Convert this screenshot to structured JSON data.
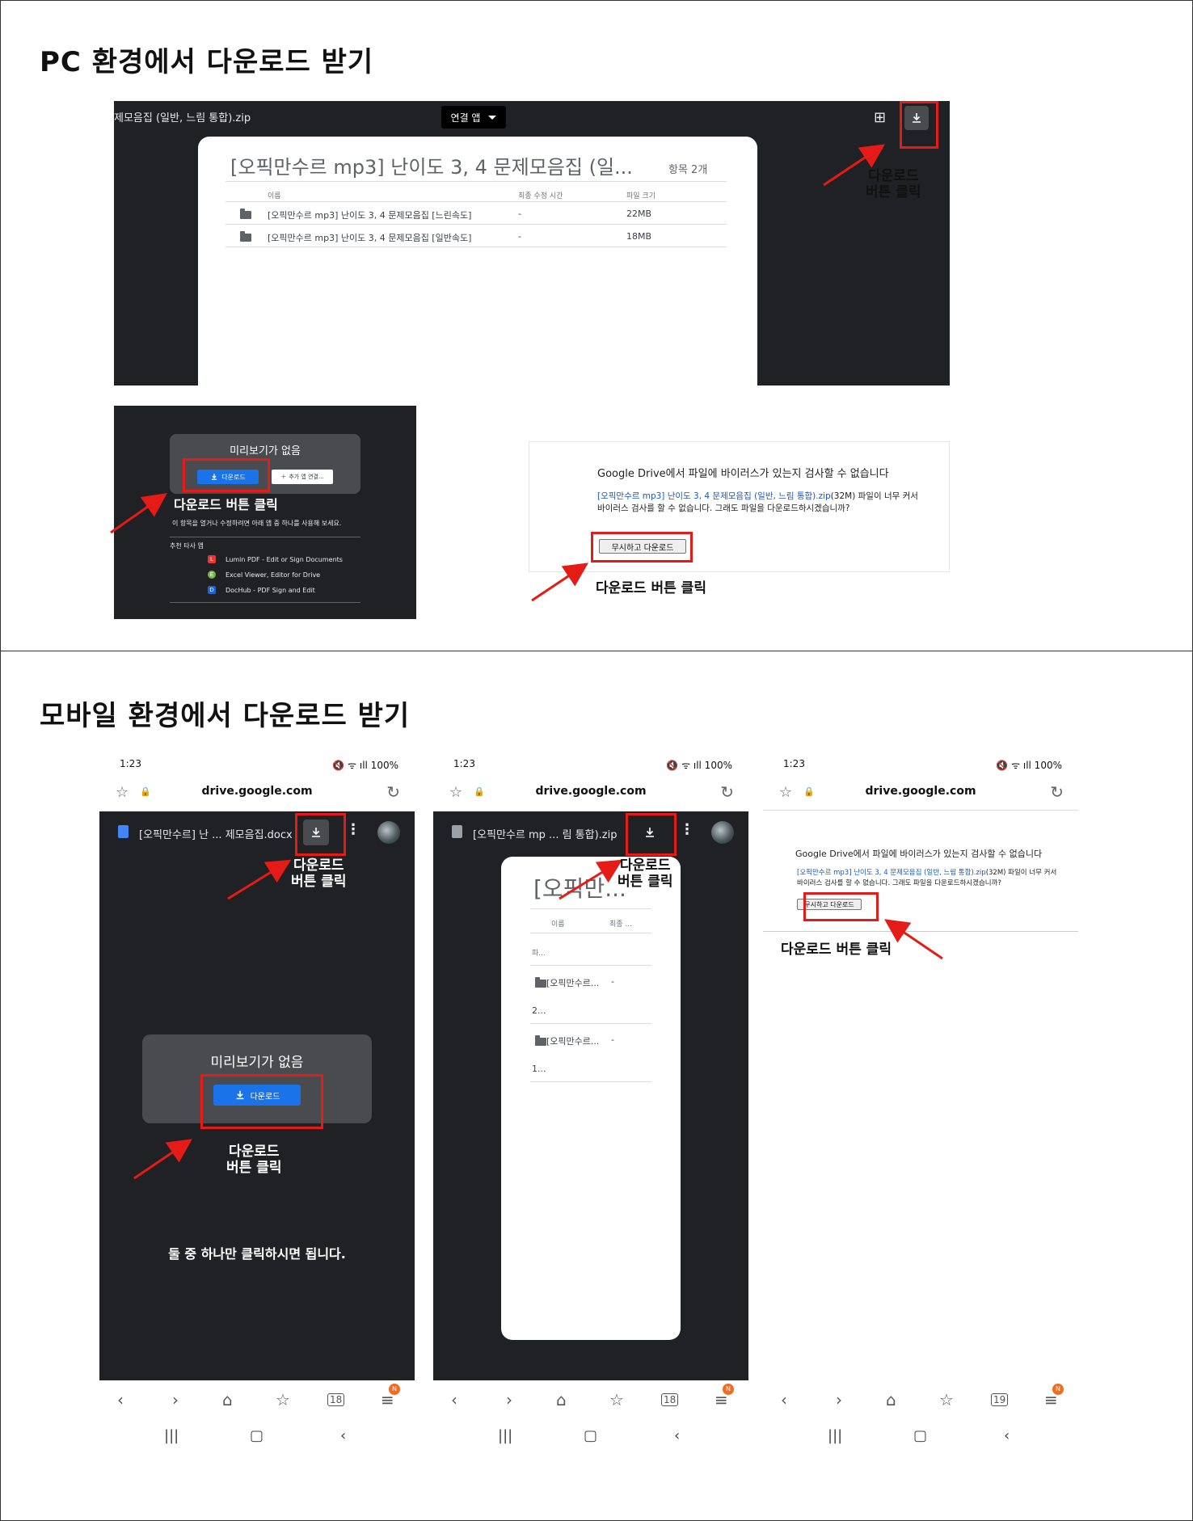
{
  "pc_section": {
    "title": "PC 환경에서 다운로드 받기",
    "viewer": {
      "filename": "제모음집 (일반, 느림 통합).zip",
      "open_with": "연결 앱",
      "folder_title": "[오픽만수르 mp3] 난이도 3, 4 문제모음집 (일...",
      "item_count": "항목 2개",
      "columns": [
        "이름",
        "최종 수정 시간",
        "파일 크기"
      ],
      "rows": [
        {
          "name": "[오픽만수르 mp3] 난이도 3, 4 문제모음집 [느린속도]",
          "modified": "-",
          "size": "22MB"
        },
        {
          "name": "[오픽만수르 mp3] 난이도 3, 4 문제모음집 [일반속도]",
          "modified": "-",
          "size": "18MB"
        }
      ],
      "annotation": "다운로드\n버튼 클릭"
    },
    "no_preview": {
      "title": "미리보기가 없음",
      "download_label": "다운로드",
      "add_app_label": "추가 앱 연결...",
      "hint": "이 항목을 열거나 수정하려면 아래 앱 중 하나를 사용해 보세요.",
      "recommended": "추천 타사 앱",
      "apps": [
        {
          "name": "Lumin PDF - Edit or Sign Documents",
          "color": "#e53935",
          "icon": "L"
        },
        {
          "name": "Excel Viewer, Editor for Drive",
          "color": "#7cb342",
          "icon": "E"
        },
        {
          "name": "DocHub - PDF Sign and Edit",
          "color": "#1e63d6",
          "icon": "D"
        }
      ],
      "annotation": "다운로드 버튼 클릭"
    },
    "virus_warning": {
      "title": "Google Drive에서 파일에 바이러스가 있는지 검사할 수 없습니다",
      "link_text": "[오픽만수르 mp3] 난이도 3, 4 문제모음집 (일반, 느림 통합).zip",
      "body_text": "(32M) 파일이 너무 커서 바이러스 검사를 할 수 없습니다. 그래도 파일을 다운로드하시겠습니까?",
      "button": "무시하고 다운로드",
      "annotation": "다운로드 버튼 클릭"
    }
  },
  "mobile_section": {
    "title": "모바일 환경에서 다운로드 받기",
    "phone1": {
      "time": "1:23",
      "status_right": "🔇 ᯤ ıll 100%",
      "url": "drive.google.com",
      "file_title": "[오픽만수르] 난 ... 제모음집.docx",
      "card_title": "미리보기가 없음",
      "download_label": "다운로드",
      "annotation_top": "다운로드\n버튼 클릭",
      "annotation_mid": "다운로드\n버튼 클릭",
      "note": "둘 중 하나만 클릭하시면 됩니다.",
      "tabs_count": "18",
      "badge": "N"
    },
    "phone2": {
      "time": "1:23",
      "status_right": "🔇 ᯤ ıll 100%",
      "url": "drive.google.com",
      "file_title": "[오픽만수르 mp ... 림 통합).zip",
      "card_title": "[오픽만...",
      "col_name": "이름",
      "col_modified": "최종 ...",
      "size_label": "파...",
      "rows": [
        {
          "name": "[오픽만수르...",
          "mod": "-",
          "size": "2..."
        },
        {
          "name": "[오픽만수르...",
          "mod": "-",
          "size": "1..."
        }
      ],
      "annotation": "다운로드\n버튼 클릭",
      "tabs_count": "18",
      "badge": "N"
    },
    "phone3": {
      "time": "1:23",
      "status_right": "🔇 ᯤ ıll 100%",
      "url": "drive.google.com",
      "title": "Google Drive에서 파일에 바이러스가 있는지 검사할 수 없습니다",
      "link_text": "[오픽만수르 mp3] 난이도 3, 4 문제모음집 (일반, 느림 통합).zip",
      "body_text": "(32M) 파일이 너무 커서 바이러스 검사를 할 수 없습니다. 그래도 파일을 다운로드하시겠습니까?",
      "button": "무시하고 다운로드",
      "annotation": "다운로드 버튼 클릭",
      "tabs_count": "19",
      "badge": "N"
    }
  },
  "colors": {
    "drive_dark": "#202124",
    "card_gray": "#4a4b4e",
    "download_blue": "#1a73e8",
    "highlight_red": "#e41b17",
    "badge_orange": "#f36b21"
  }
}
